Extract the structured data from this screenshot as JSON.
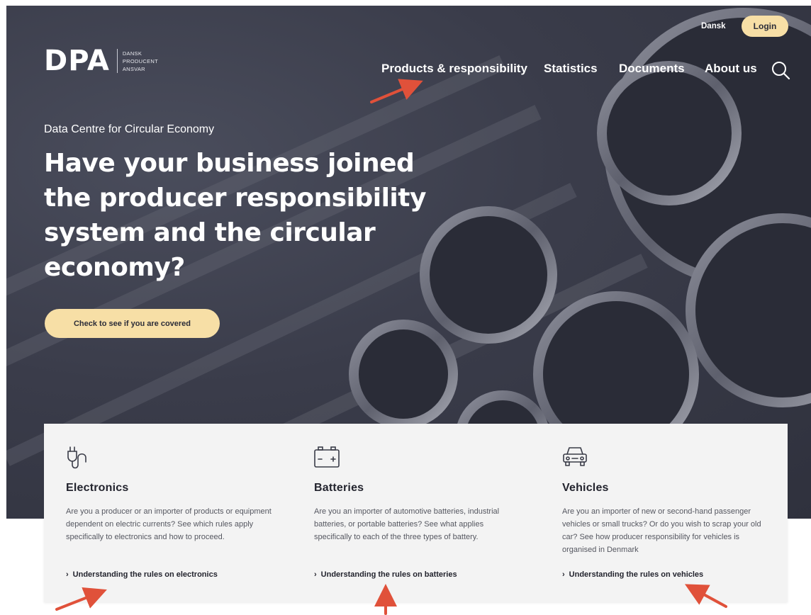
{
  "header": {
    "logo_text": "DPA",
    "logo_subtitle": [
      "DANSK",
      "PRODUCENT",
      "ANSVAR"
    ],
    "language_link": "Dansk",
    "login_label": "Login",
    "nav": [
      {
        "label": "Products & responsibility"
      },
      {
        "label": "Statistics"
      },
      {
        "label": "Documents"
      },
      {
        "label": "About us"
      }
    ],
    "search_icon": "search-icon"
  },
  "hero": {
    "eyebrow": "Data Centre for Circular Economy",
    "headline": "Have your business joined the producer responsibility system and the circular economy?",
    "cta_label": "Check to see if you are covered"
  },
  "cards": [
    {
      "icon": "plug-icon",
      "title": "Electronics",
      "description": "Are you a producer or an importer of products or equipment dependent on electric currents? See which rules apply specifically to electronics and how to proceed.",
      "link_label": "Understanding the rules on electronics"
    },
    {
      "icon": "battery-icon",
      "title": "Batteries",
      "description": "Are you an importer of automotive batteries, industrial batteries, or portable batteries? See what applies specifically to each of the three types of battery.",
      "link_label": "Understanding the rules on batteries"
    },
    {
      "icon": "car-icon",
      "title": "Vehicles",
      "description": "Are you an importer of new or second-hand passenger vehicles or small trucks? Or do you wish to scrap your old car? See how producer responsibility for vehicles is organised in Denmark",
      "link_label": "Understanding the rules on vehicles"
    }
  ],
  "colors": {
    "accent": "#f7dfa6",
    "hero_bg": "#3a3c4a",
    "annotation_arrow": "#e0513a"
  }
}
